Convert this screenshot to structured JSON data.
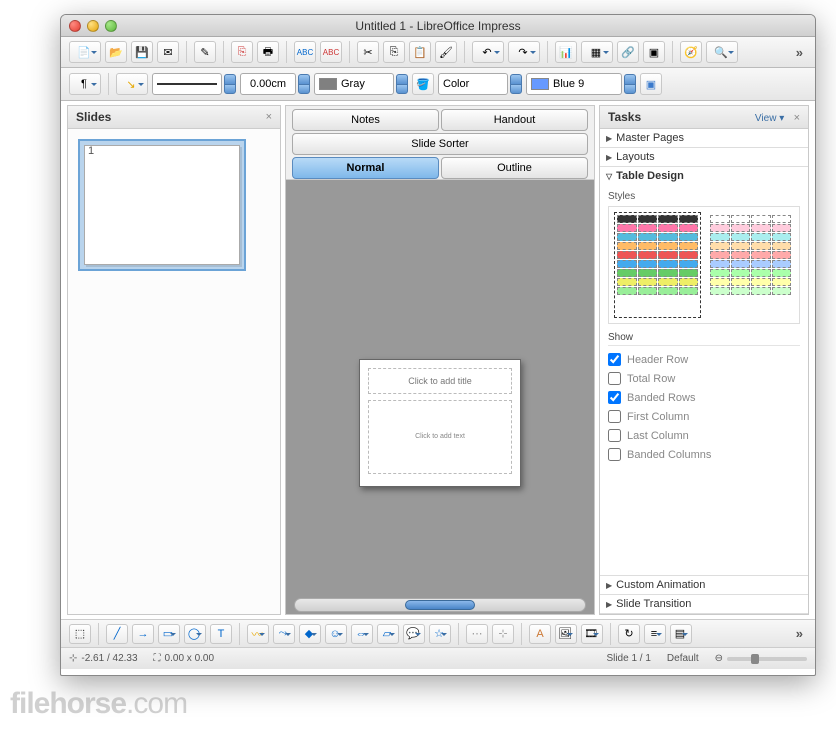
{
  "window": {
    "title": "Untitled 1 - LibreOffice Impress"
  },
  "toolbar2": {
    "lineWidth": "0.00cm",
    "lineColor": {
      "label": "Gray",
      "hex": "#808080"
    },
    "fillType": "Color",
    "fillColor": {
      "label": "Blue 9",
      "hex": "#6699ff"
    }
  },
  "slidesPanel": {
    "title": "Slides",
    "slides": [
      {
        "num": "1"
      }
    ]
  },
  "centerTabs": {
    "notes": "Notes",
    "handout": "Handout",
    "sorter": "Slide Sorter",
    "normal": "Normal",
    "outline": "Outline"
  },
  "slideEdit": {
    "titlePlaceholder": "Click to add title",
    "contentPlaceholder": "Click to add text"
  },
  "tasksPanel": {
    "title": "Tasks",
    "viewLabel": "View ▾",
    "sections": {
      "master": "Master Pages",
      "layouts": "Layouts",
      "tableDesign": "Table Design",
      "customAnim": "Custom Animation",
      "slideTrans": "Slide Transition"
    },
    "tableDesign": {
      "stylesLabel": "Styles",
      "showLabel": "Show",
      "options": {
        "headerRow": {
          "label": "Header Row",
          "checked": true
        },
        "totalRow": {
          "label": "Total Row",
          "checked": false
        },
        "bandedRows": {
          "label": "Banded Rows",
          "checked": true
        },
        "firstCol": {
          "label": "First Column",
          "checked": false
        },
        "lastCol": {
          "label": "Last Column",
          "checked": false
        },
        "bandedCols": {
          "label": "Banded Columns",
          "checked": false
        }
      }
    }
  },
  "statusbar": {
    "coords": "-2.61 / 42.33",
    "size": "0.00 x 0.00",
    "slideInfo": "Slide 1 / 1",
    "layout": "Default"
  },
  "watermark": {
    "a": "filehorse",
    "b": ".com"
  }
}
